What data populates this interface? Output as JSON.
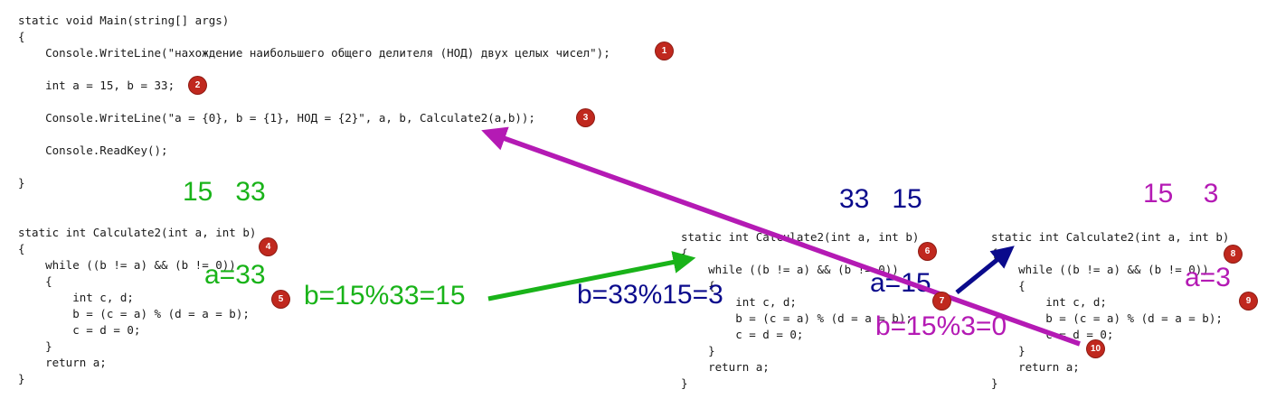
{
  "main_block": {
    "lines": [
      "static void Main(string[] args)",
      "{",
      "    Console.WriteLine(\"нахождение наибольшего общего делителя (НОД) двух целых чисел\");",
      "    int a = 15, b = 33;",
      "    Console.WriteLine(\"a = {0}, b = {1}, НОД = {2}\", a, b, Calculate2(a,b));",
      "    Console.ReadKey();",
      "}"
    ]
  },
  "calc_block_lines": [
    "static int Calculate2(int a, int b)",
    "{",
    "    while ((b != a) && (b != 0))",
    "    {",
    "        int c, d;",
    "        b = (c = a) % (d = a = b);",
    "        c = d = 0;",
    "    }",
    "    return a;",
    "}"
  ],
  "badges": [
    "1",
    "2",
    "3",
    "4",
    "5",
    "6",
    "7",
    "8",
    "9",
    "10"
  ],
  "annotations": {
    "call1_args": "15   33",
    "call1_a": "a=33",
    "call1_b": "b=15%33=15",
    "call2_args": "33   15",
    "call2_b": "b=33%15=3",
    "call2_a": "a=15",
    "call3_args": "15    3",
    "call3_a": "a=3",
    "call3_b": "b=15%3=0"
  },
  "colors": {
    "green": "#19b319",
    "blue": "#0a0a8c",
    "magenta": "#b41ab4",
    "badge": "#c0281e"
  }
}
